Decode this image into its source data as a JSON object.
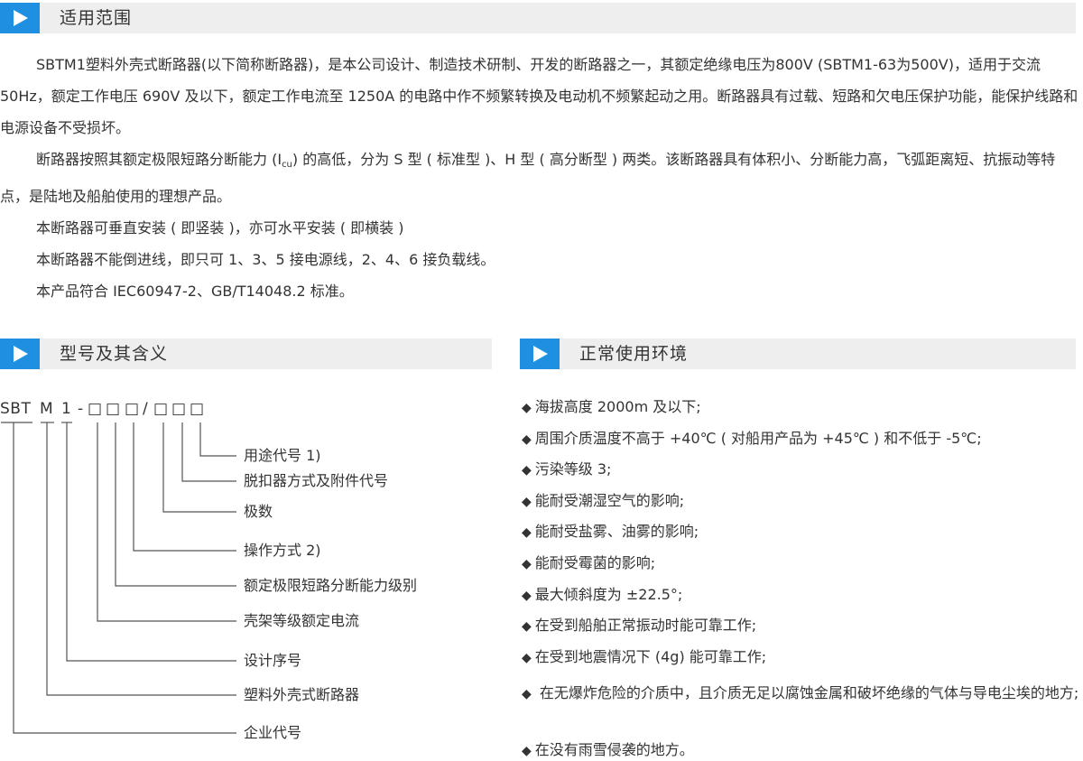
{
  "colors": {
    "accent": "#1e8fe1",
    "header_bg": "#eeeeee",
    "text": "#333333"
  },
  "sections": {
    "scope": {
      "title": "适用范围",
      "icon": "play-triangle-icon"
    },
    "model": {
      "title": "型号及其含义",
      "icon": "play-triangle-icon"
    },
    "env": {
      "title": "正常使用环境",
      "icon": "play-triangle-icon"
    }
  },
  "intro": {
    "p1": "SBTM1塑料外壳式断路器(以下简称断路器)，是本公司设计、制造技术研制、开发的断路器之一，其额定绝缘电压为800V (SBTM1-63为500V)，适用于交流 50Hz，额定工作电压 690V 及以下，额定工作电流至 1250A 的电路中作不频繁转换及电动机不频繁起动之用。断路器具有过载、短路和欠电压保护功能，能保护线路和电源设备不受损坏。",
    "p2_a": "断路器按照其额定极限短路分断能力 (I",
    "p2_sub": "cu",
    "p2_b": ") 的高低，分为 S 型 ( 标准型 )、H 型 ( 高分断型 ) 两类。该断路器具有体积小、分断能力高，飞弧距离短、抗振动等特点，是陆地及船舶使用的理想产品。",
    "p3": "本断路器可垂直安装 ( 即竖装 )，亦可水平安装 ( 即横装 )",
    "p4": "本断路器不能倒进线，即只可 1、3、5 接电源线，2、4、6 接负载线。",
    "p5": "本产品符合 IEC60947-2、GB/T14048.2 标准。"
  },
  "model_code": {
    "sbt": "SBT",
    "m": "M",
    "one": "1",
    "dash": "-",
    "box": "□",
    "slash": "/",
    "labels": [
      "用途代号 1)",
      "脱扣器方式及附件代号",
      "极数",
      "操作方式 2)",
      "额定极限短路分断能力级别",
      "壳架等级额定电流",
      "设计序号",
      "塑料外壳式断路器",
      "企业代号"
    ]
  },
  "environment": {
    "bullet": "◆",
    "items": [
      "海拔高度 2000m 及以下;",
      "周围介质温度不高于 +40℃ ( 对船用产品为 +45℃ ) 和不低于 -5℃;",
      "污染等级 3;",
      "能耐受潮湿空气的影响;",
      "能耐受盐雾、油雾的影响;",
      "能耐受霉菌的影响;",
      "最大倾斜度为 ±22.5°;",
      "在受到船舶正常振动时能可靠工作;",
      "在受到地震情况下 (4g) 能可靠工作;",
      " 在无爆炸危险的介质中，且介质无足以腐蚀金属和破坏绝缘的气体与导电尘埃的地方;",
      "在没有雨雪侵袭的地方。"
    ]
  }
}
